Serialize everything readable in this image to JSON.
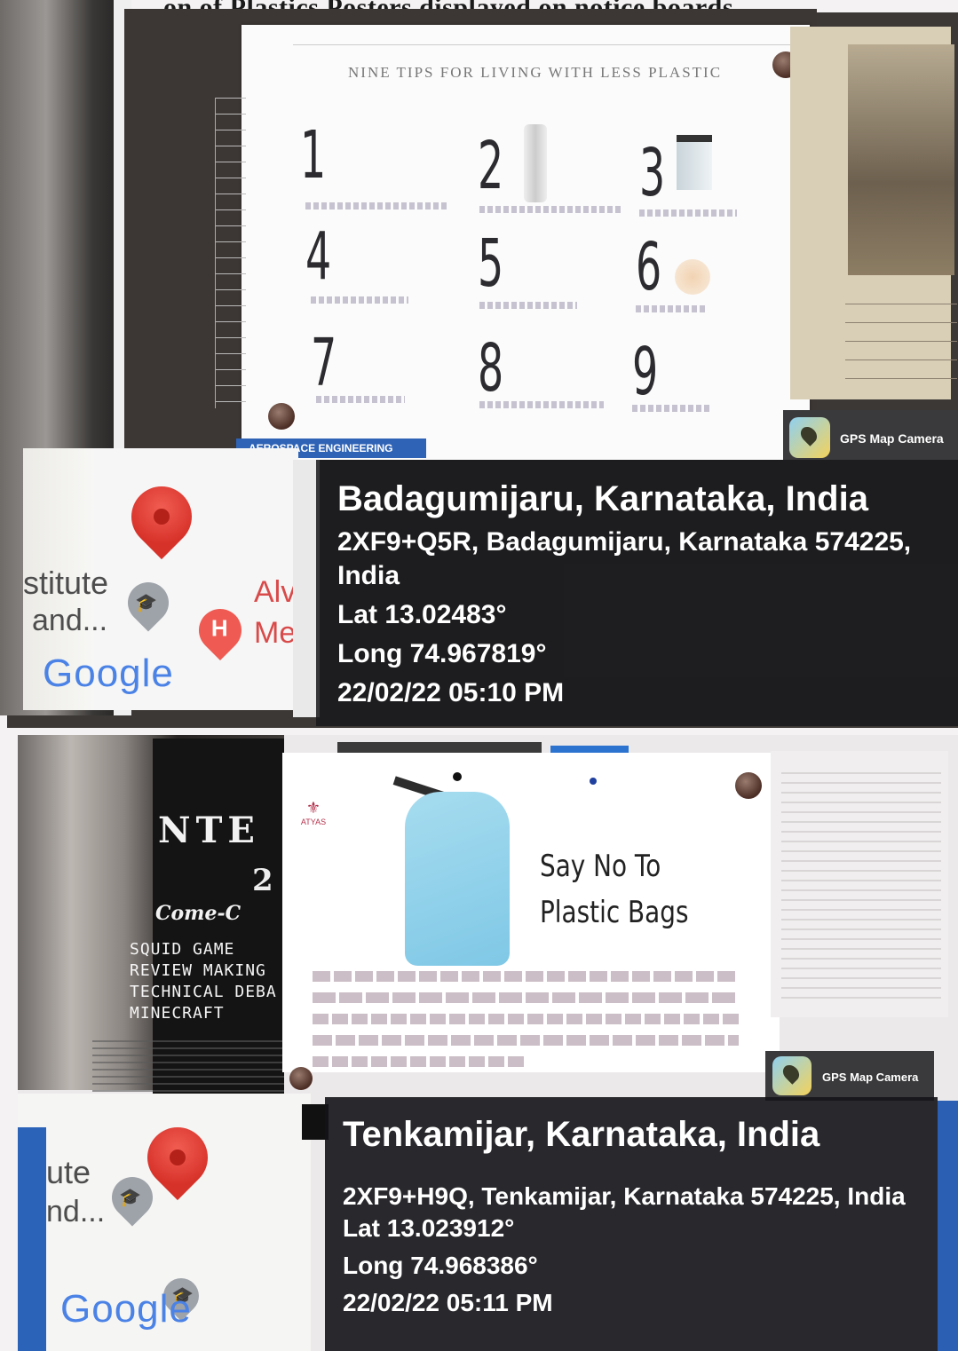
{
  "heading": "...on of Plastics Posters displayed on notice boards",
  "photo1": {
    "poster_title": "NINE TIPS FOR LIVING WITH LESS PLASTIC",
    "tip_numbers": [
      "1",
      "2",
      "3",
      "4",
      "5",
      "6",
      "7",
      "8",
      "9"
    ],
    "department_label": "AEROSPACE ENGINEERING",
    "gps_badge": "GPS Map Camera",
    "map": {
      "label_institute": "stitute",
      "label_and": "and...",
      "label_alv": "Alv",
      "label_me": "Me",
      "hospital_glyph": "H",
      "google_logo": "Google"
    },
    "info": {
      "place": "Badagumijaru, Karnataka, India",
      "address_line1": "2XF9+Q5R, Badagumijaru, Karnataka 574225,",
      "address_line2": "India",
      "lat": "Lat 13.02483°",
      "long": "Long 74.967819°",
      "datetime": "22/02/22 05:10 PM"
    }
  },
  "photo2": {
    "bookpanel_title": "NTE",
    "bookpanel_number": "2",
    "bookpanel_subtitle": "Come-C",
    "bookpanel_items": [
      "SQUID GAME",
      "REVIEW MAKING",
      "TECHNICAL DEBA",
      "MINECRAFT"
    ],
    "poster_heading": "Say No To\nPlastic Bags",
    "poster_logo": "ATYAS",
    "gps_badge": "GPS Map Camera",
    "map": {
      "label_ute": "ute",
      "label_nd": "nd...",
      "google_logo": "Google"
    },
    "info": {
      "place": "Tenkamijar, Karnataka, India",
      "address": "2XF9+H9Q, Tenkamijar, Karnataka 574225, India",
      "lat": "Lat 13.023912°",
      "long": "Long 74.968386°",
      "datetime": "22/02/22 05:11 PM"
    }
  },
  "colors": {
    "map_pin_red": "#d7322a",
    "overlay_dark": "#19191c",
    "department_blue": "#2f63b6"
  },
  "icons": [
    "map-pin-icon",
    "school-pin-icon",
    "hospital-pin-icon",
    "gps-map-camera-icon",
    "thumbtack-icon"
  ]
}
